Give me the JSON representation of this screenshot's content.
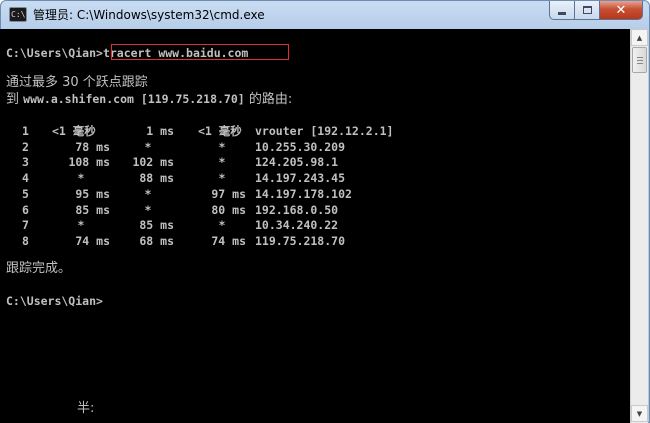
{
  "window": {
    "title": "管理员: C:\\Windows\\system32\\cmd.exe",
    "icon": "cmd-icon",
    "icon_text": "C:\\",
    "buttons": {
      "minimize": "minimize-icon",
      "maximize": "maximize-icon",
      "close": "close-icon",
      "close_glyph": "✕"
    }
  },
  "console": {
    "prompt1": "C:\\Users\\Qian>",
    "command": "tracert www.baidu.com",
    "header_line1": "通过最多 30 个跃点跟踪",
    "header_line2_a": "到 ",
    "header_line2_b": "www.a.shifen.com [119.75.218.70]",
    "header_line2_c": " 的路由:",
    "hops": [
      {
        "n": "1",
        "t1": "<1 毫秒",
        "t2": "1 ms",
        "t3": "<1 毫秒",
        "host": "vrouter [192.12.2.1]"
      },
      {
        "n": "2",
        "t1": "78 ms",
        "t2": "*",
        "t3": "*",
        "host": "10.255.30.209"
      },
      {
        "n": "3",
        "t1": "108 ms",
        "t2": "102 ms",
        "t3": "*",
        "host": "124.205.98.1"
      },
      {
        "n": "4",
        "t1": "*",
        "t2": "88 ms",
        "t3": "*",
        "host": "14.197.243.45"
      },
      {
        "n": "5",
        "t1": "95 ms",
        "t2": "*",
        "t3": "97 ms",
        "host": "14.197.178.102"
      },
      {
        "n": "6",
        "t1": "85 ms",
        "t2": "*",
        "t3": "80 ms",
        "host": "192.168.0.50"
      },
      {
        "n": "7",
        "t1": "*",
        "t2": "85 ms",
        "t3": "*",
        "host": "10.34.240.22"
      },
      {
        "n": "8",
        "t1": "74 ms",
        "t2": "68 ms",
        "t3": "74 ms",
        "host": "119.75.218.70"
      }
    ],
    "complete": "跟踪完成。",
    "prompt2": "C:\\Users\\Qian>",
    "ime_status": "半:"
  },
  "colors": {
    "console_bg": "#000000",
    "console_text": "#c0c0c0",
    "highlight_box": "#e03030"
  }
}
